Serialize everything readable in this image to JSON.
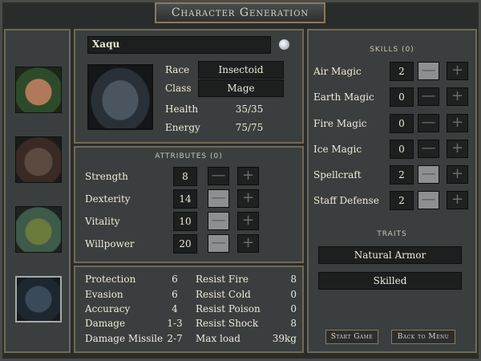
{
  "window": {
    "title": "Character Generation"
  },
  "character": {
    "name": "Xaqu",
    "race_label": "Race",
    "race": "Insectoid",
    "class_label": "Class",
    "class": "Mage",
    "health_label": "Health",
    "health": "35/35",
    "energy_label": "Energy",
    "energy": "75/75"
  },
  "attributes": {
    "title": "ATTRIBUTES (0)",
    "items": [
      {
        "label": "Strength",
        "value": "8"
      },
      {
        "label": "Dexterity",
        "value": "14"
      },
      {
        "label": "Vitality",
        "value": "10"
      },
      {
        "label": "Willpower",
        "value": "20"
      }
    ]
  },
  "stats": {
    "left": [
      {
        "label": "Protection",
        "value": "6"
      },
      {
        "label": "Evasion",
        "value": "6"
      },
      {
        "label": "Accuracy",
        "value": "4"
      },
      {
        "label": "Damage",
        "value": "1-3"
      },
      {
        "label": "Damage Missile",
        "value": "2-7"
      }
    ],
    "right": [
      {
        "label": "Resist Fire",
        "value": "8"
      },
      {
        "label": "Resist Cold",
        "value": "0"
      },
      {
        "label": "Resist Poison",
        "value": "0"
      },
      {
        "label": "Resist Shock",
        "value": "8"
      },
      {
        "label": "Max load",
        "value": "39kg"
      }
    ]
  },
  "skills": {
    "title": "SKILLS (0)",
    "items": [
      {
        "label": "Air Magic",
        "value": "2"
      },
      {
        "label": "Earth Magic",
        "value": "0"
      },
      {
        "label": "Fire Magic",
        "value": "0"
      },
      {
        "label": "Ice Magic",
        "value": "0"
      },
      {
        "label": "Spellcraft",
        "value": "2"
      },
      {
        "label": "Staff Defense",
        "value": "2"
      }
    ]
  },
  "traits": {
    "title": "TRAITS",
    "items": [
      "Natural Armor",
      "Skilled"
    ]
  },
  "buttons": {
    "minus": "—",
    "plus": "+",
    "start": "Start Game",
    "back": "Back to Menu"
  },
  "colors": {
    "accent_gold": "#8a7a55",
    "panel": "#3b3e3e"
  }
}
